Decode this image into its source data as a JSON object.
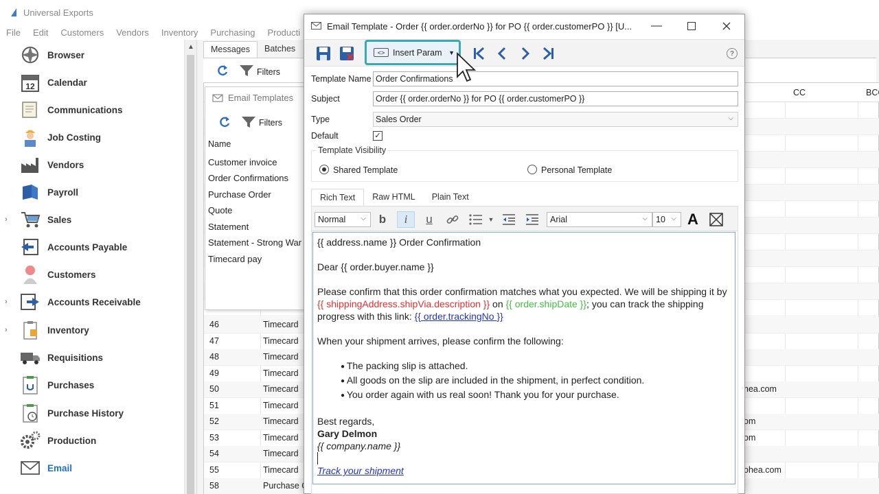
{
  "app": {
    "title": "Universal Exports",
    "menu": [
      "File",
      "Edit",
      "Customers",
      "Vendors",
      "Inventory",
      "Purchasing",
      "Producti"
    ]
  },
  "sidebar": {
    "items": [
      {
        "label": "Browser",
        "icon": "browser-icon"
      },
      {
        "label": "Calendar",
        "icon": "calendar-icon",
        "day": "12"
      },
      {
        "label": "Communications",
        "icon": "communications-icon"
      },
      {
        "label": "Job Costing",
        "icon": "worker-icon"
      },
      {
        "label": "Vendors",
        "icon": "factory-icon"
      },
      {
        "label": "Payroll",
        "icon": "payroll-icon"
      },
      {
        "label": "Sales",
        "icon": "cart-icon",
        "expandable": true
      },
      {
        "label": "Accounts Payable",
        "icon": "accounts-payable-icon"
      },
      {
        "label": "Customers",
        "icon": "customers-icon"
      },
      {
        "label": "Accounts Receivable",
        "icon": "accounts-receivable-icon",
        "expandable": true
      },
      {
        "label": "Inventory",
        "icon": "inventory-icon",
        "expandable": true
      },
      {
        "label": "Requisitions",
        "icon": "truck-icon"
      },
      {
        "label": "Purchases",
        "icon": "purchases-icon"
      },
      {
        "label": "Purchase History",
        "icon": "purchase-history-icon"
      },
      {
        "label": "Production",
        "icon": "gears-icon"
      },
      {
        "label": "Email",
        "icon": "envelope-icon",
        "active": true
      }
    ]
  },
  "main": {
    "tabs": [
      "Messages",
      "Batches"
    ],
    "filters_label": "Filters",
    "grid_headers": {
      "cc": "CC",
      "bcc": "BCC"
    },
    "rows": [
      {
        "id": "46",
        "type": "Timecard",
        "cc": ""
      },
      {
        "id": "47",
        "type": "Timecard",
        "cc": ""
      },
      {
        "id": "48",
        "type": "Timecard",
        "cc": ""
      },
      {
        "id": "49",
        "type": "Timecard",
        "cc": ""
      },
      {
        "id": "50",
        "type": "Timecard",
        "cc": "hea.com"
      },
      {
        "id": "51",
        "type": "Timecard",
        "cc": ""
      },
      {
        "id": "52",
        "type": "Timecard",
        "cc": "om"
      },
      {
        "id": "53",
        "type": "Timecard",
        "cc": "om"
      },
      {
        "id": "54",
        "type": "Timecard",
        "cc": ""
      },
      {
        "id": "55",
        "type": "Timecard",
        "cc": "ohea.com"
      },
      {
        "id": "58",
        "type": "Purchase C",
        "cc": ""
      }
    ]
  },
  "templates_panel": {
    "title": "Email Templates",
    "filters_label": "Filters",
    "column": "Name",
    "items": [
      "Customer invoice",
      "Order Confirmations",
      "Purchase Order",
      "Quote",
      "Statement",
      "Statement - Strong War",
      "Timecard pay"
    ],
    "selected_index": 1
  },
  "dialog": {
    "title": "Email Template - Order {{ order.orderNo }} for PO {{ order.customerPO }} [U...",
    "toolbar": {
      "insert_param": "Insert Param",
      "help": "?"
    },
    "fields": {
      "template_name_label": "Template Name",
      "template_name": "Order Confirmations",
      "subject_label": "Subject",
      "subject": "Order {{ order.orderNo }} for PO {{ order.customerPO }}",
      "type_label": "Type",
      "type": "Sales Order",
      "default_label": "Default",
      "default_checked": "✓"
    },
    "visibility": {
      "legend": "Template Visibility",
      "shared": "Shared Template",
      "personal": "Personal Template",
      "selected": "shared"
    },
    "editor_tabs": [
      "Rich Text",
      "Raw HTML",
      "Plain Text"
    ],
    "editor_toolbar": {
      "style": "Normal",
      "font": "Arial",
      "size": "10"
    },
    "body": {
      "line1": "{{ address.name }} Order Confirmation",
      "line2": "Dear {{ order.buyer.name }}",
      "p3a": "Please confirm that this order confirmation matches what you expected. We will be shipping it by ",
      "p3_shipvia": "{{ shippingAddress.shipVia.description }}",
      "p3_on": " on ",
      "p3_date": "{{ order.shipDate }}",
      "p3b": "; you can track the shipping progress with this link: ",
      "p3_link": "{{ order.trackingNo }}",
      "line4": "When your shipment arrives, please confirm the following:",
      "bullets": [
        "The packing slip is attached.",
        "All goods on the slip are included in the shipment, in perfect condition.",
        "You order again with us real soon! Thank you for your purchase."
      ],
      "regards": "Best regards,",
      "signature": "Gary Delmon",
      "company": "{{ company.name }}",
      "track_link": "Track your shipment"
    }
  }
}
